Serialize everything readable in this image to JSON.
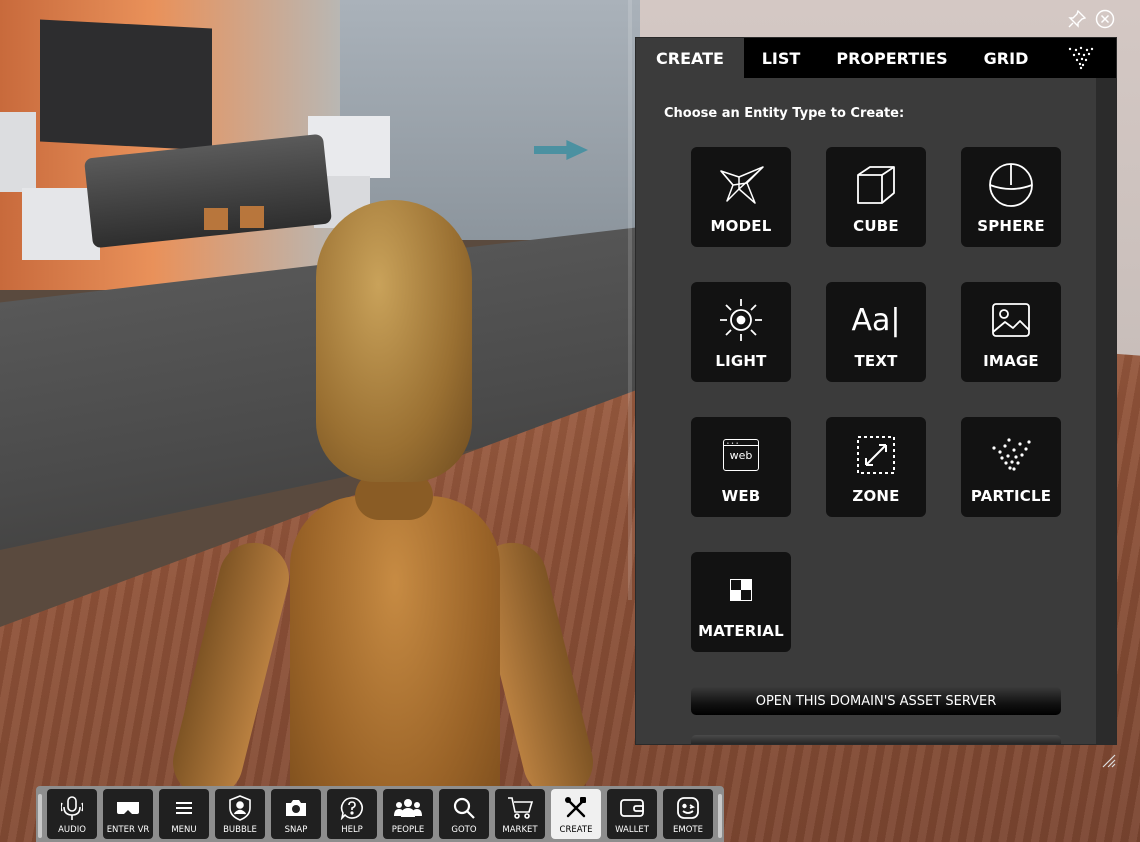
{
  "panel": {
    "tabs": [
      {
        "label": "CREATE",
        "active": true
      },
      {
        "label": "LIST",
        "active": false
      },
      {
        "label": "PROPERTIES",
        "active": false
      },
      {
        "label": "GRID",
        "active": false
      },
      {
        "icon": "particle-icon",
        "active": false
      }
    ],
    "heading": "Choose an Entity Type to Create:",
    "entity_types": [
      {
        "label": "MODEL",
        "icon": "model-icon"
      },
      {
        "label": "CUBE",
        "icon": "cube-icon"
      },
      {
        "label": "SPHERE",
        "icon": "sphere-icon"
      },
      {
        "label": "LIGHT",
        "icon": "light-icon"
      },
      {
        "label": "TEXT",
        "icon": "text-icon",
        "icon_text": "Aa|"
      },
      {
        "label": "IMAGE",
        "icon": "image-icon"
      },
      {
        "label": "WEB",
        "icon": "web-icon",
        "icon_text": "web"
      },
      {
        "label": "ZONE",
        "icon": "zone-icon"
      },
      {
        "label": "PARTICLE",
        "icon": "particle-icon"
      },
      {
        "label": "MATERIAL",
        "icon": "material-icon"
      }
    ],
    "asset_server_button": "OPEN THIS DOMAIN'S ASSET SERVER"
  },
  "toolbar": {
    "buttons": [
      {
        "label": "AUDIO",
        "icon": "microphone-icon",
        "active": false
      },
      {
        "label": "ENTER VR",
        "icon": "vr-headset-icon",
        "active": false
      },
      {
        "label": "MENU",
        "icon": "menu-icon",
        "active": false
      },
      {
        "label": "BUBBLE",
        "icon": "bubble-shield-icon",
        "active": false
      },
      {
        "label": "SNAP",
        "icon": "camera-icon",
        "active": false
      },
      {
        "label": "HELP",
        "icon": "help-icon",
        "active": false
      },
      {
        "label": "PEOPLE",
        "icon": "people-icon",
        "active": false
      },
      {
        "label": "GOTO",
        "icon": "search-icon",
        "active": false
      },
      {
        "label": "MARKET",
        "icon": "cart-icon",
        "active": false
      },
      {
        "label": "CREATE",
        "icon": "create-tools-icon",
        "active": true
      },
      {
        "label": "WALLET",
        "icon": "wallet-icon",
        "active": false
      },
      {
        "label": "EMOTE",
        "icon": "emote-icon",
        "active": false
      }
    ]
  },
  "colors": {
    "panel_bg": "#3b3b3b",
    "tab_bar_bg": "#000000",
    "tile_bg": "#121212",
    "toolbar_bg": "#8e8e8e",
    "toolbar_button_bg": "#202020",
    "toolbar_active_bg": "#f0f0f0"
  }
}
